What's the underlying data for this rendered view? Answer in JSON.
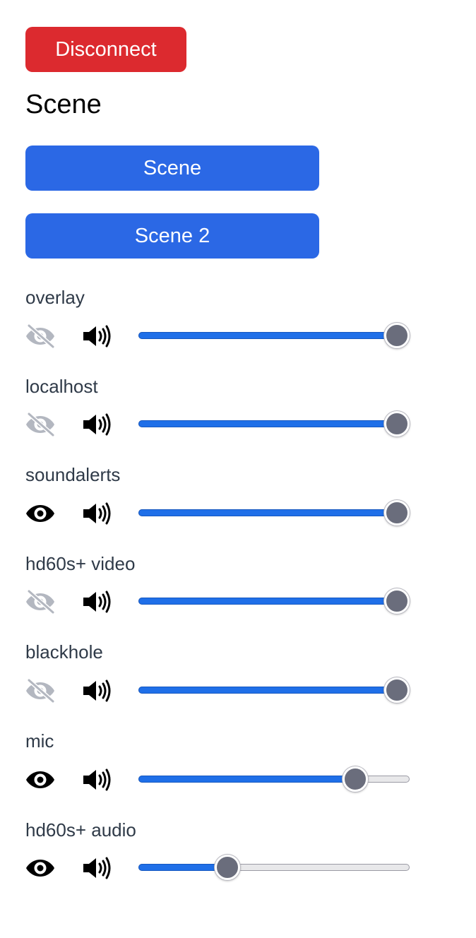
{
  "colors": {
    "disconnect": "#dc2a2f",
    "scene_button": "#2b68e5",
    "label": "#2f3a48",
    "hidden_icon": "#b3b7c0",
    "visible_icon": "#000000"
  },
  "disconnect_label": "Disconnect",
  "scenes_heading": "Scene",
  "scenes": [
    {
      "label": "Scene"
    },
    {
      "label": "Scene 2"
    }
  ],
  "sources": [
    {
      "name": "overlay",
      "visible": false,
      "volume_percent": 100,
      "visibility_icon": "eye-slash-icon",
      "audio_icon": "volume-high-icon"
    },
    {
      "name": "localhost",
      "visible": false,
      "volume_percent": 100,
      "visibility_icon": "eye-slash-icon",
      "audio_icon": "volume-high-icon"
    },
    {
      "name": "soundalerts",
      "visible": true,
      "volume_percent": 100,
      "visibility_icon": "eye-icon",
      "audio_icon": "volume-high-icon"
    },
    {
      "name": "hd60s+ video",
      "visible": false,
      "volume_percent": 100,
      "visibility_icon": "eye-slash-icon",
      "audio_icon": "volume-high-icon"
    },
    {
      "name": "blackhole",
      "visible": false,
      "volume_percent": 100,
      "visibility_icon": "eye-slash-icon",
      "audio_icon": "volume-high-icon"
    },
    {
      "name": "mic",
      "visible": true,
      "volume_percent": 83,
      "visibility_icon": "eye-icon",
      "audio_icon": "volume-high-icon"
    },
    {
      "name": "hd60s+ audio",
      "visible": true,
      "volume_percent": 31,
      "visibility_icon": "eye-icon",
      "audio_icon": "volume-high-icon"
    }
  ]
}
